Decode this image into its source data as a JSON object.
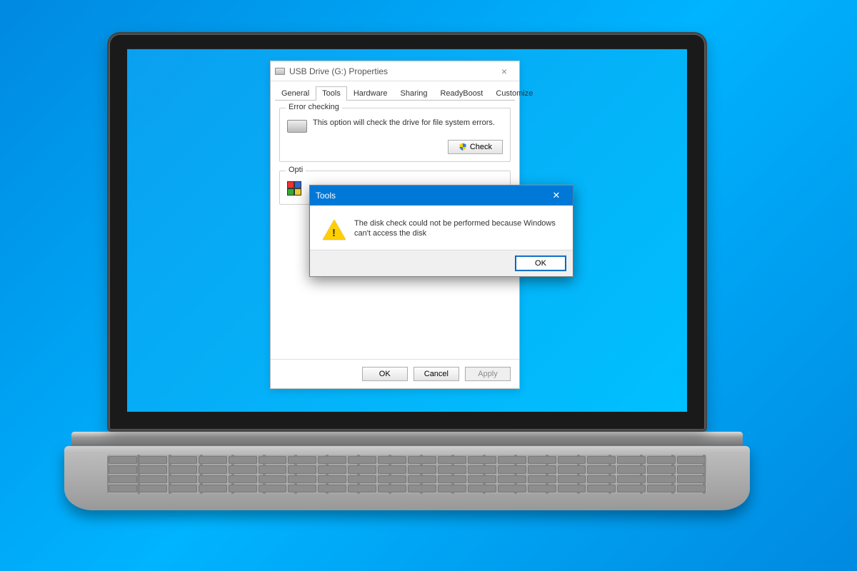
{
  "properties": {
    "title": "USB Drive (G:) Properties",
    "tabs": [
      "General",
      "Tools",
      "Hardware",
      "Sharing",
      "ReadyBoost",
      "Customize"
    ],
    "active_tab": 1,
    "error_check": {
      "group_label": "Error checking",
      "text": "This option will check the drive for file system errors.",
      "button": "Check"
    },
    "optimize": {
      "group_label": "Opti"
    },
    "footer": {
      "ok": "OK",
      "cancel": "Cancel",
      "apply": "Apply"
    }
  },
  "dialog": {
    "title": "Tools",
    "message": "The disk check could not be performed because Windows can't access the disk",
    "ok": "OK"
  }
}
